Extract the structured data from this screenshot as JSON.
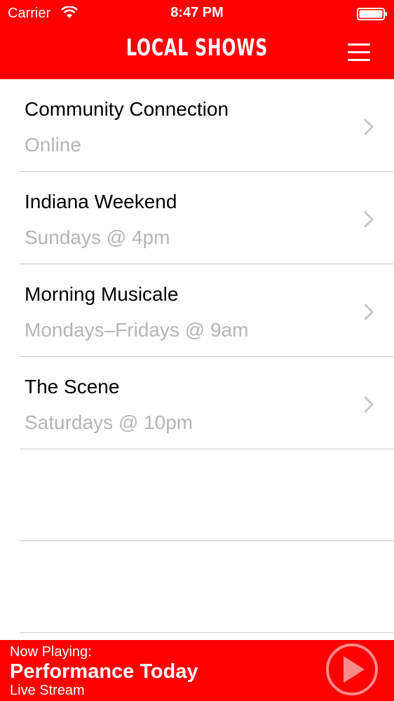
{
  "status_bar": {
    "carrier": "Carrier",
    "time": "8:47 PM",
    "wifi_icon": "wifi-icon",
    "battery_icon": "battery-icon"
  },
  "header": {
    "title": "LOCAL SHOWS",
    "menu_icon": "hamburger-menu-icon"
  },
  "shows": [
    {
      "title": "Community Connection",
      "schedule": "Online"
    },
    {
      "title": "Indiana Weekend",
      "schedule": "Sundays @ 4pm"
    },
    {
      "title": "Morning Musicale",
      "schedule": "Mondays–Fridays @ 9am"
    },
    {
      "title": "The Scene",
      "schedule": "Saturdays @ 10pm"
    }
  ],
  "player": {
    "label": "Now Playing:",
    "title": "Performance Today",
    "subtitle": "Live Stream",
    "play_icon": "play-icon"
  },
  "colors": {
    "accent": "#ff0000",
    "subtitle_gray": "#b5b5b5",
    "separator": "#c8c7cc"
  }
}
